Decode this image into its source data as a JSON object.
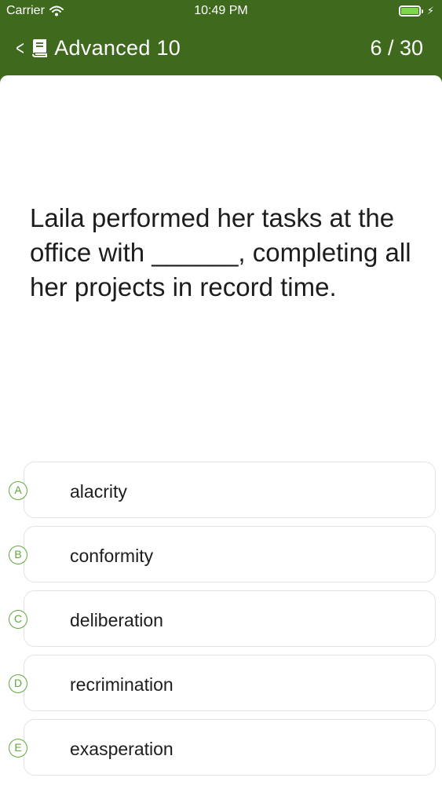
{
  "status_bar": {
    "carrier": "Carrier",
    "time": "10:49 PM",
    "battery_level": 1.0,
    "icons": [
      "wifi-icon",
      "battery-icon",
      "bolt-icon"
    ]
  },
  "nav": {
    "back_icon": "chevron-left-icon",
    "book_icon": "book-icon",
    "title": "Advanced 10",
    "counter": "6 / 30"
  },
  "colors": {
    "header_green": "#3f6a1e",
    "option_letter_green": "#5fa83a"
  },
  "question": {
    "text": "Laila performed her tasks at the office with ______, completing all her projects in record time."
  },
  "options": [
    {
      "letter": "A",
      "label": "alacrity"
    },
    {
      "letter": "B",
      "label": "conformity"
    },
    {
      "letter": "C",
      "label": "deliberation"
    },
    {
      "letter": "D",
      "label": "recrimination"
    },
    {
      "letter": "E",
      "label": "exasperation"
    }
  ]
}
